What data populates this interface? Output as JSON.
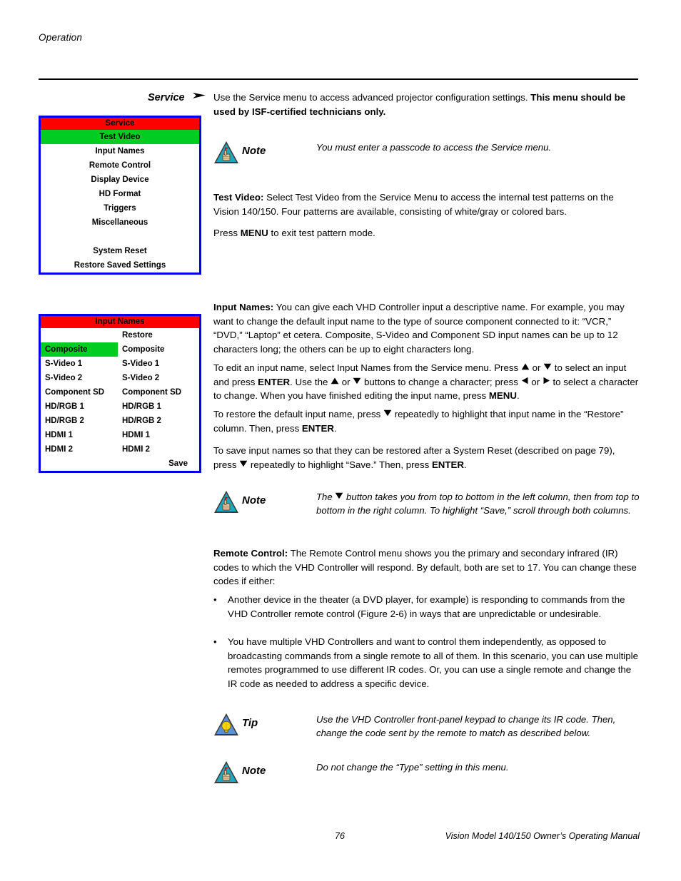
{
  "page": {
    "running_head": "Operation",
    "footer_page_number": "76",
    "footer_title": "Vision Model 140/150 Owner’s Operating Manual"
  },
  "colors": {
    "osd_border": "#0000EE",
    "osd_title_bg": "#FF0000",
    "osd_highlight_bg": "#00CC22",
    "note_icon_fill": "#1EA8BE",
    "tip_icon_fill": "#5B8FD6",
    "tip_bulb_fill": "#FFD400"
  },
  "margin_labels": {
    "service": "Service"
  },
  "service_menu": {
    "title": "Service",
    "items": [
      {
        "label": "Test Video",
        "selected": true
      },
      {
        "label": "Input Names",
        "selected": false
      },
      {
        "label": "Remote Control",
        "selected": false
      },
      {
        "label": "Display Device",
        "selected": false
      },
      {
        "label": "HD Format",
        "selected": false
      },
      {
        "label": "Triggers",
        "selected": false
      },
      {
        "label": "Miscellaneous",
        "selected": false
      },
      {
        "label": "",
        "selected": false
      },
      {
        "label": "System Reset",
        "selected": false
      },
      {
        "label": "Restore Saved Settings",
        "selected": false
      }
    ]
  },
  "input_names_menu": {
    "title": "Input Names",
    "restore_header": "Restore",
    "save_label": "Save",
    "rows": [
      {
        "name": "Composite",
        "restore": "Composite",
        "selected": true
      },
      {
        "name": "S-Video 1",
        "restore": "S-Video 1",
        "selected": false
      },
      {
        "name": "S-Video 2",
        "restore": "S-Video 2",
        "selected": false
      },
      {
        "name": "Component SD",
        "restore": "Component SD",
        "selected": false
      },
      {
        "name": "HD/RGB 1",
        "restore": "HD/RGB 1",
        "selected": false
      },
      {
        "name": "HD/RGB 2",
        "restore": "HD/RGB 2",
        "selected": false
      },
      {
        "name": "HDMI 1",
        "restore": "HDMI 1",
        "selected": false
      },
      {
        "name": "HDMI 2",
        "restore": "HDMI 2",
        "selected": false
      }
    ]
  },
  "body": {
    "service_intro_normal": "Use the Service menu to access advanced projector configuration settings. ",
    "service_intro_bold": "This menu should be used by ISF-certified technicians only.",
    "note_service_keyword": "Note",
    "note_service_text": "You must enter a passcode to access the Service menu.",
    "test_video_label": "Test Video:",
    "test_video_text": " Select Test Video from the Service Menu to access the internal test patterns on the Vision 140/150. Four patterns are available, consisting of white/gray or colored bars.",
    "press_menu_pre": "Press ",
    "press_menu_bold": "MENU",
    "press_menu_post": " to exit test pattern mode.",
    "input_names_label": "Input Names:",
    "input_names_text": " You can give each VHD Controller input a descriptive name. For example, you may want to change the default input name to the type of source component connected to it: “VCR,” “DVD,” “Laptop” et cetera. Composite, S-Video and Component SD input names can be up to 12 characters long; the others can be up to eight characters long.",
    "edit_p1": "To edit an input name, select Input Names from the Service menu. Press ",
    "edit_p2": " or ",
    "edit_p3": " to select an input and press ",
    "edit_enter1": "ENTER",
    "edit_p4": ". Use the ",
    "edit_p5": " or ",
    "edit_p6": " buttons to change a character; press ",
    "edit_p7": " or ",
    "edit_p8": " to select a character to change. When you have finished editing the input name, press ",
    "edit_menu": "MENU",
    "edit_p9": ".",
    "restore_p1": "To restore the default input name, press ",
    "restore_p2": " repeatedly to highlight that input name in the “Restore” column. Then, press ",
    "restore_enter": "ENTER",
    "restore_p3": ".",
    "save_p1": "To save input names so that they can be restored after a System Reset (described on page 79), press ",
    "save_p2": " repeatedly to highlight “Save.” Then, press ",
    "save_enter": "ENTER",
    "save_p3": ".",
    "note_columns_keyword": "Note",
    "note_columns_p1": "The ",
    "note_columns_p2": " button takes you from top to bottom in the left column, then from top to bottom in the right column. To highlight “Save,” scroll through both columns.",
    "remote_control_label": "Remote Control:",
    "remote_control_text": " The Remote Control menu shows you the primary and secondary infrared (IR) codes to which the VHD Controller will respond. By default, both are set to 17. You can change these codes if either:",
    "bullet_marker": "•",
    "bullet_1": "Another device in the theater (a DVD player, for example) is responding to commands from the VHD Controller remote control (Figure 2-6) in ways that are unpredictable or undesirable.",
    "bullet_2": "You have multiple VHD Controllers and want to control them independently, as opposed to broadcasting commands from a single remote to all of them. In this scenario, you can use multiple remotes programmed to use different IR codes. Or, you can use a single remote and change the IR code as needed to address a specific device.",
    "tip_keyword": "Tip",
    "tip_text": "Use the VHD Controller front-panel keypad to change its IR code. Then, change the code sent by the remote to match as described below.",
    "note_type_keyword": "Note",
    "note_type_text": "Do not change the “Type” setting in this menu."
  },
  "icons": {
    "section_arrow": "right-arrow-icon",
    "note": "note-triangle-icon",
    "tip": "tip-lightbulb-icon",
    "up_arrow": "up-triangle-icon",
    "down_arrow": "down-triangle-icon",
    "left_arrow": "left-triangle-icon",
    "right_arrow": "right-triangle-icon"
  }
}
